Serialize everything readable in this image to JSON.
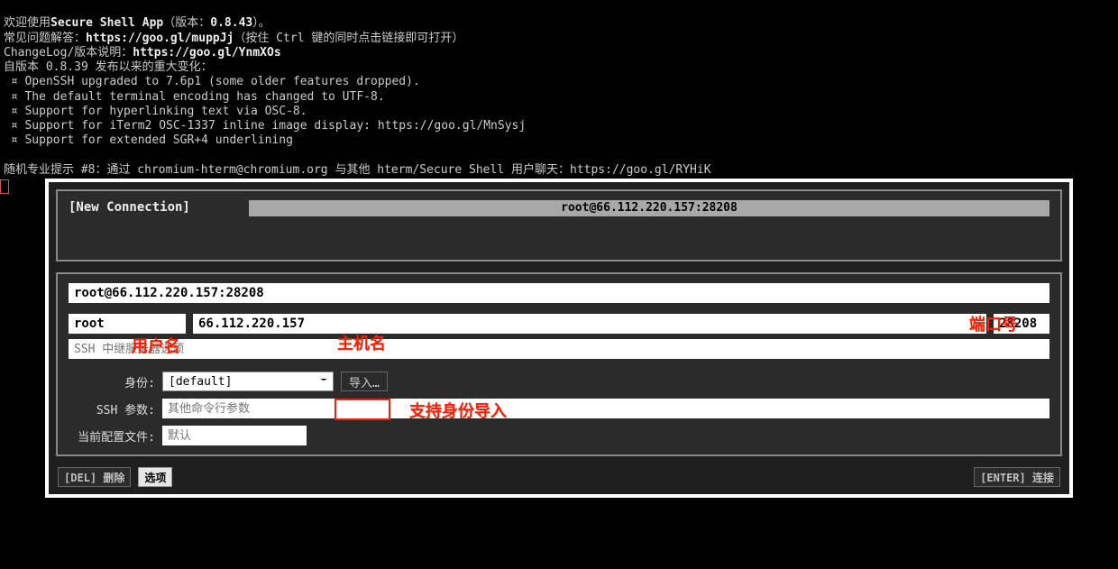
{
  "intro": {
    "line1_pre": "欢迎使用",
    "line1_app": "Secure Shell App",
    "line1_ver_open": "（版本：",
    "line1_ver": "0.8.43",
    "line1_ver_close": "）。",
    "faq_label": "常见问题解答：",
    "faq_url": "https://goo.gl/muppJj",
    "faq_hint": "（按住 Ctrl 键的同时点击链接即可打开）",
    "changelog_label": "ChangeLog/版本说明：",
    "changelog_url": "https://goo.gl/YnmXOs",
    "since_label": "自版本 0.8.39 发布以来的重大变化：",
    "bullets": [
      "OpenSSH upgraded to 7.6p1 (some older features dropped).",
      "The default terminal encoding has changed to UTF-8.",
      "Support for hyperlinking text via OSC-8.",
      "Support for iTerm2 OSC-1337 inline image display: https://goo.gl/MnSysj",
      "Support for extended SGR+4 underlining"
    ],
    "tip": "随机专业提示 #8：通过 chromium-hterm@chromium.org 与其他 hterm/Secure Shell 用户聊天：https://goo.gl/RYHiK"
  },
  "dialog": {
    "new_connection": "[New Connection]",
    "existing_connection": "root@66.112.220.157:28208",
    "full_string": "root@66.112.220.157:28208",
    "user": "root",
    "host": "66.112.220.157",
    "port": "28208",
    "relay_placeholder": "SSH 中继服务器选项",
    "labels": {
      "identity": "身份:",
      "ssh_args": "SSH 参数:",
      "profile": "当前配置文件:"
    },
    "identity_selected": "[default]",
    "import_button": "导入…",
    "ssh_args_placeholder": "其他命令行参数",
    "profile_placeholder": "默认",
    "buttons": {
      "delete": "[DEL] 删除",
      "options": "选项",
      "enter": "[ENTER] 连接"
    }
  },
  "annotations": {
    "user": "用户名",
    "host": "主机名",
    "port": "端口号",
    "import": "支持身份导入"
  }
}
